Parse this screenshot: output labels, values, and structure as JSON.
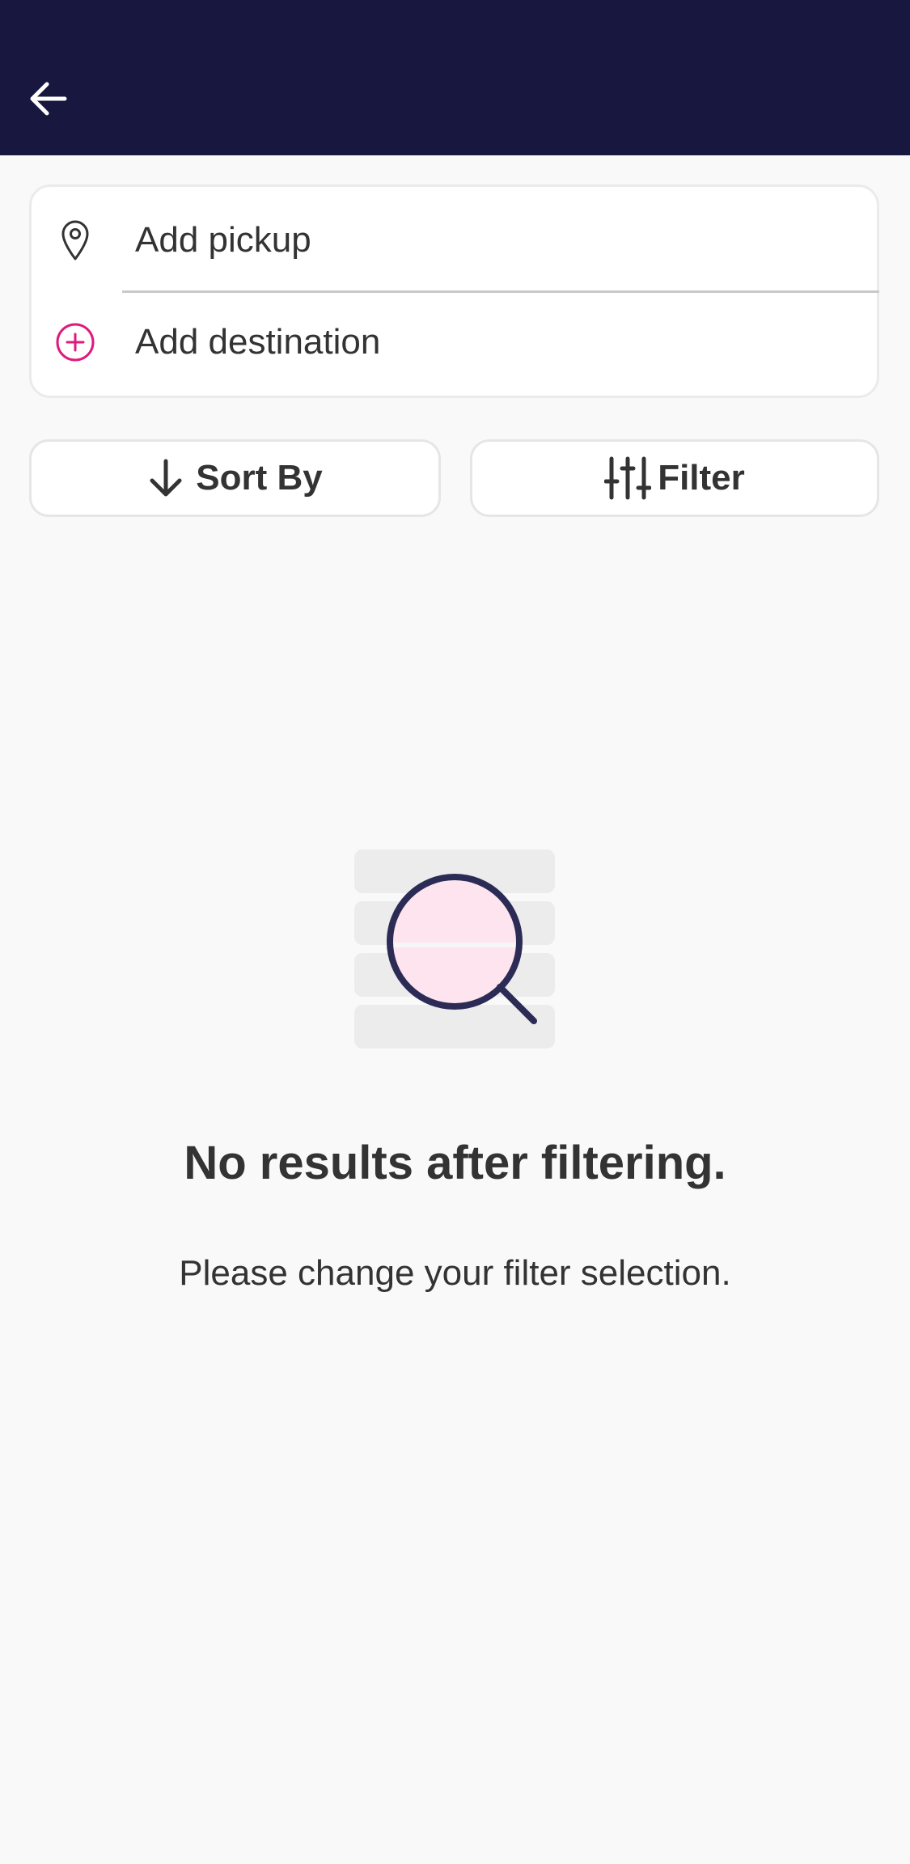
{
  "header": {
    "back_icon": "arrow-left-icon",
    "background_color": "#17173f"
  },
  "location": {
    "pickup_label": "Add pickup",
    "pickup_icon": "map-pin-icon",
    "destination_label": "Add destination",
    "destination_icon": "plus-circle-icon",
    "accent_color": "#e0197d"
  },
  "actions": {
    "sort_label": "Sort By",
    "sort_icon": "arrow-down-icon",
    "filter_label": "Filter",
    "filter_icon": "sliders-icon"
  },
  "empty_state": {
    "illustration_icon": "magnifier-list-icon",
    "title": "No results after filtering.",
    "subtitle": "Please change your filter selection."
  }
}
